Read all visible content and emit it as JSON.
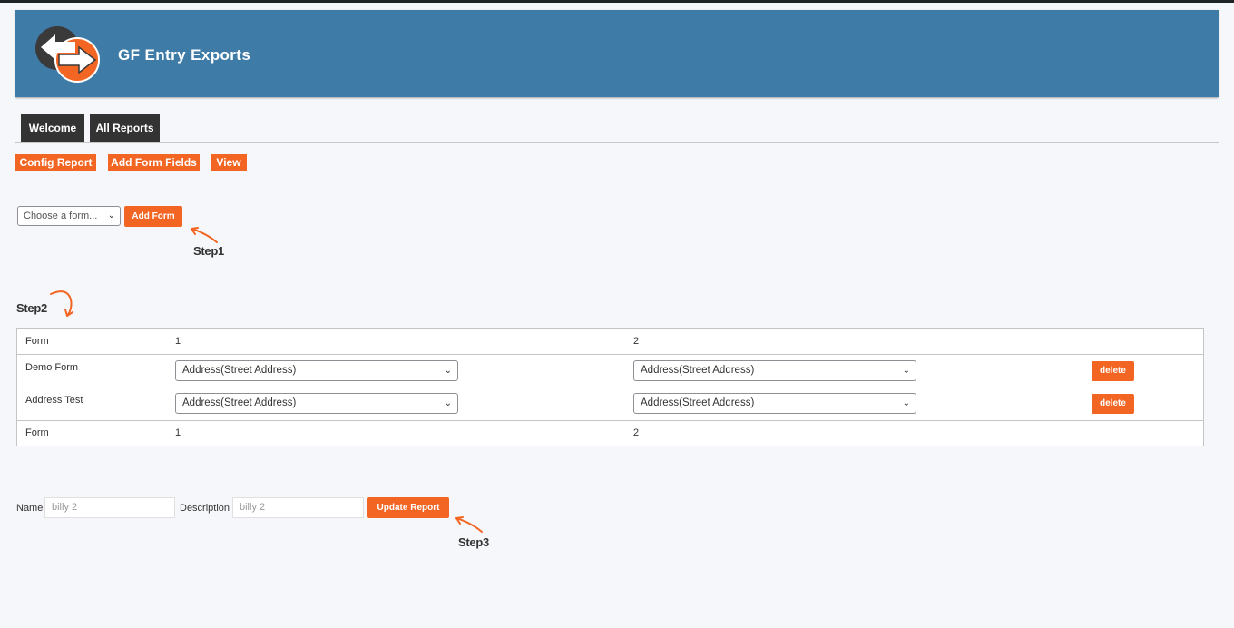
{
  "header": {
    "title": "GF Entry Exports"
  },
  "tabs": [
    {
      "label": "Welcome"
    },
    {
      "label": "All Reports"
    }
  ],
  "subnav": [
    {
      "label": "Config Report"
    },
    {
      "label": "Add Form Fields"
    },
    {
      "label": "View"
    }
  ],
  "form_picker": {
    "selected": "Choose a form...",
    "add_label": "Add Form"
  },
  "steps": {
    "step1": "Step1",
    "step2": "Step2",
    "step3": "Step3"
  },
  "table": {
    "header": [
      "Form",
      "1",
      "2"
    ],
    "rows": [
      {
        "form": "Demo Form",
        "field1": "Address(Street Address)",
        "field2": "Address(Street Address)",
        "action": "delete"
      },
      {
        "form": "Address Test",
        "field1": "Address(Street Address)",
        "field2": "Address(Street Address)",
        "action": "delete"
      }
    ],
    "footer": [
      "Form",
      "1",
      "2"
    ]
  },
  "report": {
    "name_label": "Name",
    "name_placeholder": "billy 2",
    "description_label": "Description",
    "description_placeholder": "billy 2",
    "update_label": "Update Report"
  },
  "icons": {
    "logo": "gf-export-arrows-logo",
    "arrow": "hand-drawn-arrow-icon",
    "dropdown": "chevron-down-icon"
  },
  "colors": {
    "header": "#3e7ba7",
    "accent": "#f26522",
    "tab": "#333333"
  }
}
